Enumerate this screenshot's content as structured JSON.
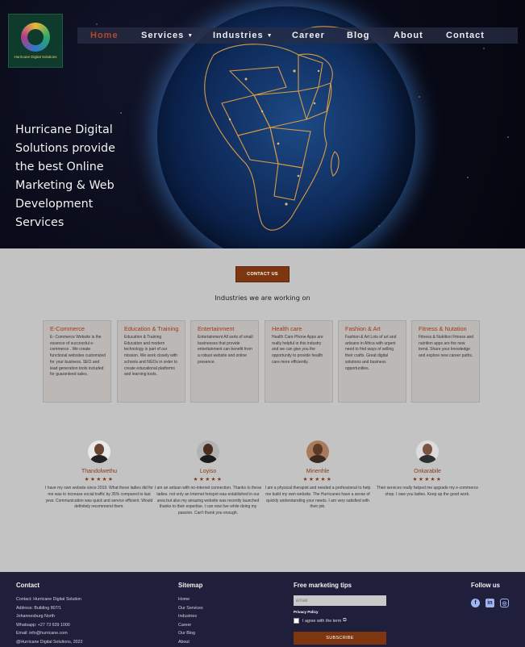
{
  "logo": {
    "text": "Hurricane Digital Solutions"
  },
  "nav": [
    {
      "label": "Home",
      "active": true
    },
    {
      "label": "Services",
      "dropdown": true
    },
    {
      "label": "Industries",
      "dropdown": true
    },
    {
      "label": "Career"
    },
    {
      "label": "Blog"
    },
    {
      "label": "About"
    },
    {
      "label": "Contact"
    }
  ],
  "hero": {
    "title": "Hurricane Digital Solutions provide the best Online Marketing & Web Development Services"
  },
  "contact_button": "CONTACT US",
  "industries": {
    "title": "Industries we are working on",
    "cards": [
      {
        "title": "E-Commerce",
        "body": "E- Commerce Website is the essence of successful e-commerce . We create functional websites customized for your business. SEO and lead generation tools included for guaranteed sales."
      },
      {
        "title": "Education & Training",
        "body": "Education & Training Education and modern technology is part of our mission. We work closely with schools and NGOs in order to create educational platforms and learning tools."
      },
      {
        "title": "Entertainment",
        "body": "Entertainment All sorts of small businesses that provide entertainment can benefit from a robust website and online presence."
      },
      {
        "title": "Health care",
        "body": "Health Care Phone Apps are really helpful in this industry and we can give you the opportunity to provide health care more efficiently."
      },
      {
        "title": "Fashion & Art",
        "body": "Fashion & Art Lots of art and artisans in Africa with urgent need to find ways of selling their crafts. Great digital solutions and business opportunities."
      },
      {
        "title": "Fitness & Nutation",
        "body": "Fitness & Nutrition Fitness and nutrition apps are the new trend. Share your knowledge and explore new career paths."
      }
    ]
  },
  "testimonials": [
    {
      "name": "Thandolwethu",
      "stars": "★★★★★",
      "quote": "I have my own website since 2019. What these ladies did for me was to increase social traffic by 35% compared to last year. Communication was quick and service efficient. Would definitely recommend them."
    },
    {
      "name": "Loyiso",
      "stars": "★★★★★",
      "quote": "I am an artisan with no-internet connection. Thanks to these ladies. not only an Internet hotspot was established in our area but also my amazing website was recently launched thanks to their expertise. I can now live while doing my passion. Can't thank you enough."
    },
    {
      "name": "Minenhle",
      "stars": "★★★★★",
      "quote": "I am a physical therapist and needed a professional to help me build my own website. The Hurricanes have a sense of quickly understanding your needs. I am very satisfied with their job."
    },
    {
      "name": "Onkarabile",
      "stars": "★★★★★",
      "quote": "Their services really helped me upgrade my e-commerce shop. I owe you ladies. Keep up the good work."
    }
  ],
  "footer": {
    "contact": {
      "heading": "Contact",
      "lines": [
        "Contact: Hurricane Digital Solution",
        "Address: Building 807/1",
        "Johannesburg North",
        "Whatsapp: +27 73 639 1000",
        "Email: info@hurricane.com",
        "@Hurricane Digital Solutions, 2022"
      ]
    },
    "sitemap": {
      "heading": "Sitemap",
      "links": [
        "Home",
        "Our Services",
        "Industries",
        "Career",
        "Our Blog",
        "About"
      ]
    },
    "newsletter": {
      "heading": "Free marketing tips",
      "email_placeholder": "email",
      "privacy": "Privacy Policy",
      "agree": "I agree with the term",
      "subscribe": "SUBSCRIBE"
    },
    "follow": {
      "heading": "Follow us",
      "icons": [
        "facebook-icon",
        "linkedin-icon",
        "instagram-icon"
      ]
    }
  }
}
